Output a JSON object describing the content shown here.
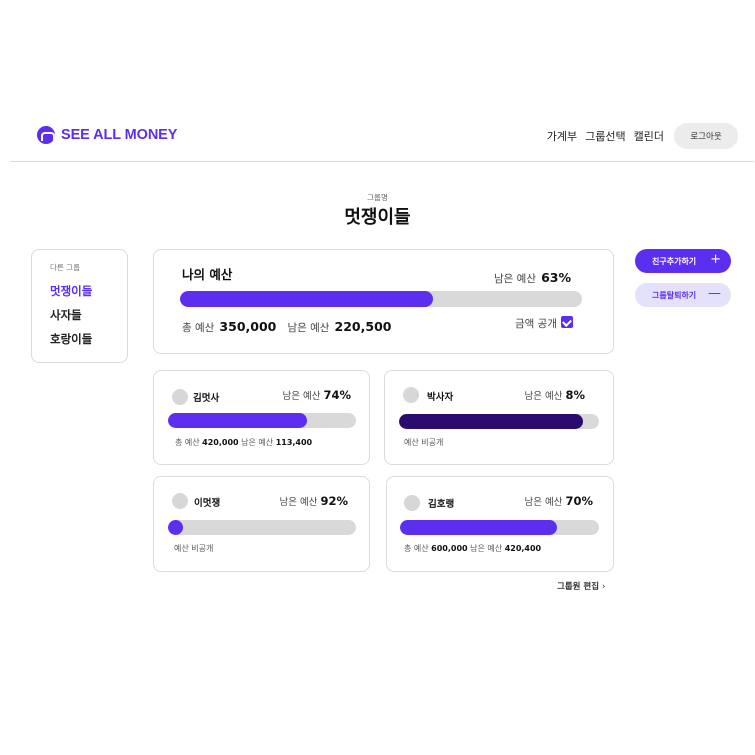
{
  "header": {
    "brand": "SEE ALL MONEY",
    "nav": [
      "가계부",
      "그룹선택",
      "캘린더"
    ],
    "logout_label": "로그아웃"
  },
  "group": {
    "caption": "그룹명",
    "title": "멋쟁이들"
  },
  "sidebar": {
    "heading": "다른 그룹",
    "items": [
      "멋쟁이들",
      "사자들",
      "호랑이들"
    ],
    "active_index": 0
  },
  "my_budget": {
    "title": "나의 예산",
    "remain_label": "남은 예산",
    "remain_percent_text": "63%",
    "remain_fraction": 0.63,
    "total_label": "총 예산",
    "total_value": "350,000",
    "remain_amount_label": "남은 예산",
    "remain_amount_value": "220,500",
    "public_label": "금액 공개",
    "public_checked": true
  },
  "members": [
    {
      "name": "김멋사",
      "remain_label": "남은 예산",
      "remain_percent_text": "74%",
      "remain_fraction": 0.74,
      "bar_color": "#5b2ef0",
      "total_label": "총 예산",
      "total_value": "420,000",
      "remain_amount_label": "남은 예산",
      "remain_amount_value": "113,400",
      "private_text": ""
    },
    {
      "name": "박사자",
      "remain_label": "남은 예산",
      "remain_percent_text": "8%",
      "remain_fraction": 0.92,
      "bar_color": "#2a0b6e",
      "private_text": "예산 비공개"
    },
    {
      "name": "이멋쟁",
      "remain_label": "남은 예산",
      "remain_percent_text": "92%",
      "remain_fraction": 0.04,
      "bar_color": "#5b2ef0",
      "private_text": "예산 비공개"
    },
    {
      "name": "김호랭",
      "remain_label": "남은 예산",
      "remain_percent_text": "70%",
      "remain_fraction": 0.79,
      "bar_color": "#5b2ef0",
      "total_label": "총 예산",
      "total_value": "600,000",
      "remain_amount_label": "남은 예산",
      "remain_amount_value": "420,400",
      "private_text": ""
    }
  ],
  "actions": {
    "add_friend_label": "친구추가하기",
    "add_friend_icon": "plus-icon",
    "leave_group_label": "그룹탈퇴하기",
    "leave_group_icon": "minus-icon",
    "edit_members_label": "그룹원 편집",
    "edit_members_icon": "chevron-right-icon"
  },
  "colors": {
    "accent": "#5b2ef0",
    "accent_dark": "#2a0b6e",
    "track": "#d9d9d9"
  }
}
